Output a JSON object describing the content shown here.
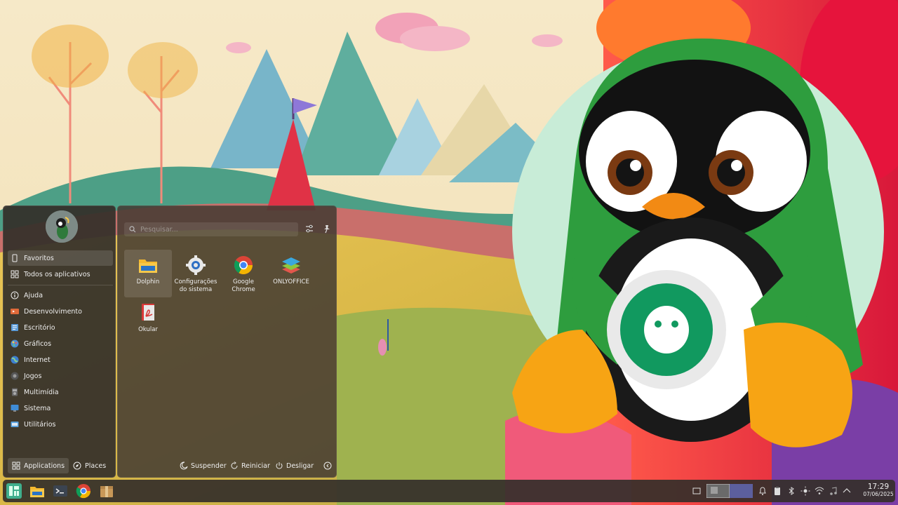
{
  "launcher": {
    "search_placeholder": "Pesquisar...",
    "categories": [
      {
        "label": "Favoritos",
        "icon": "bookmark-icon"
      },
      {
        "label": "Todos os aplicativos",
        "icon": "grid-icon"
      },
      {
        "label": "Ajuda",
        "icon": "help-icon"
      },
      {
        "label": "Desenvolvimento",
        "icon": "development-icon"
      },
      {
        "label": "Escritório",
        "icon": "office-icon"
      },
      {
        "label": "Gráficos",
        "icon": "graphics-icon"
      },
      {
        "label": "Internet",
        "icon": "internet-icon"
      },
      {
        "label": "Jogos",
        "icon": "games-icon"
      },
      {
        "label": "Multimídia",
        "icon": "multimedia-icon"
      },
      {
        "label": "Sistema",
        "icon": "system-icon"
      },
      {
        "label": "Utilitários",
        "icon": "utilities-icon"
      }
    ],
    "apps": [
      {
        "label": "Dolphin",
        "icon": "dolphin-folder-icon"
      },
      {
        "label": "Configurações do sistema",
        "icon": "settings-gear-icon"
      },
      {
        "label": "Google Chrome",
        "icon": "chrome-icon"
      },
      {
        "label": "ONLYOFFICE",
        "icon": "onlyoffice-icon"
      },
      {
        "label": "Okular",
        "icon": "okular-pdf-icon"
      }
    ],
    "tabs": {
      "applications": "Applications",
      "places": "Places"
    },
    "power": {
      "suspend": "Suspender",
      "restart": "Reiniciar",
      "shutdown": "Desligar"
    }
  },
  "taskbar": {
    "time": "17:29",
    "date": "07/06/2025",
    "launchers": [
      "app-launcher-icon",
      "dolphin-icon",
      "konsole-icon",
      "chrome-icon",
      "package-icon"
    ]
  },
  "colors": {
    "panel": "#342f2a",
    "accent": "#5c5f9e",
    "launcher_green": "#3fae8d"
  }
}
